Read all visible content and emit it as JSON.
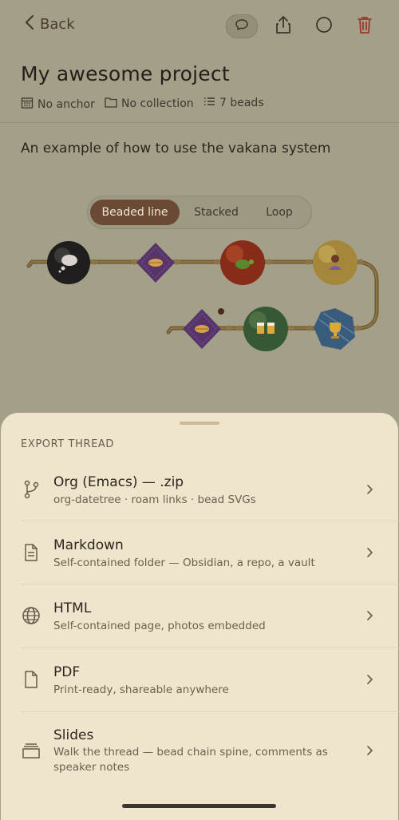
{
  "header": {
    "back_label": "Back",
    "colors": {
      "accent": "#6a4a33",
      "delete": "#9a3a2a"
    }
  },
  "project": {
    "title": "My awesome project",
    "anchor": "No anchor",
    "collection": "No collection",
    "beads": "7 beads",
    "description": "An example of how to use the vakana system"
  },
  "view_tabs": [
    {
      "label": "Beaded line",
      "active": true
    },
    {
      "label": "Stacked",
      "active": false
    },
    {
      "label": "Loop",
      "active": false
    }
  ],
  "bead_chain": [
    {
      "shape": "circle",
      "icon": "thought-bubble-icon",
      "color": "#2c2a2a"
    },
    {
      "shape": "diamond",
      "icon": "handshake-icon",
      "color": "#5c3a6e"
    },
    {
      "shape": "circle",
      "icon": "turtle-icon",
      "color": "#8b2e1c"
    },
    {
      "shape": "circle",
      "icon": "person-icon",
      "color": "#a88a3a"
    },
    {
      "shape": "hexagon",
      "icon": "trophy-icon",
      "color": "#3d5f7e"
    },
    {
      "shape": "circle",
      "icon": "beer-mugs-icon",
      "color": "#3a5a35"
    },
    {
      "shape": "diamond",
      "icon": "handshake-icon",
      "color": "#5c3a6e"
    }
  ],
  "export": {
    "title": "EXPORT THREAD",
    "options": [
      {
        "title": "Org (Emacs) — .zip",
        "subtitle": "org-datetree · roam links · bead SVGs",
        "icon": "branch-icon"
      },
      {
        "title": "Markdown",
        "subtitle": "Self-contained folder — Obsidian, a repo, a vault",
        "icon": "document-icon"
      },
      {
        "title": "HTML",
        "subtitle": "Self-contained page, photos embedded",
        "icon": "globe-icon"
      },
      {
        "title": "PDF",
        "subtitle": "Print-ready, shareable anywhere",
        "icon": "file-icon"
      },
      {
        "title": "Slides",
        "subtitle": "Walk the thread — bead chain spine, comments as speaker notes",
        "icon": "slides-icon"
      }
    ]
  }
}
